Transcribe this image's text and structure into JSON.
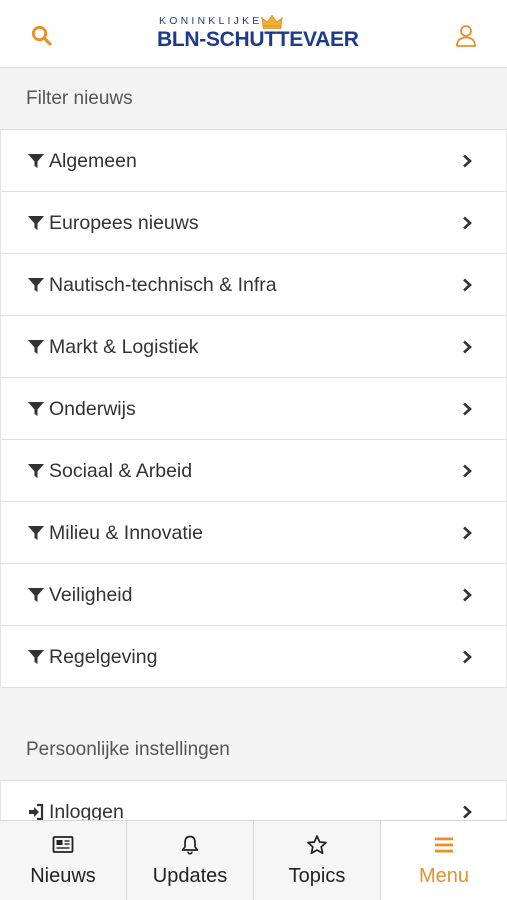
{
  "header": {
    "logo_top": "KONINKLIJKE",
    "logo_main": "BLN-SCHUTTEVAER",
    "search_icon": "search-icon",
    "user_icon": "user-icon"
  },
  "colors": {
    "accent": "#e8902a",
    "brand_blue": "#1e3a8a",
    "background": "#f4f4f4"
  },
  "filter": {
    "title": "Filter nieuws",
    "items": [
      {
        "label": "Algemeen",
        "icon": "filter-icon"
      },
      {
        "label": "Europees nieuws",
        "icon": "filter-icon"
      },
      {
        "label": "Nautisch-technisch & Infra",
        "icon": "filter-icon"
      },
      {
        "label": "Markt & Logistiek",
        "icon": "filter-icon"
      },
      {
        "label": "Onderwijs",
        "icon": "filter-icon"
      },
      {
        "label": "Sociaal & Arbeid",
        "icon": "filter-icon"
      },
      {
        "label": "Milieu & Innovatie",
        "icon": "filter-icon"
      },
      {
        "label": "Veiligheid",
        "icon": "filter-icon"
      },
      {
        "label": "Regelgeving",
        "icon": "filter-icon"
      }
    ]
  },
  "settings": {
    "title": "Persoonlijke instellingen",
    "items": [
      {
        "label": "Inloggen",
        "icon": "sign-in-icon"
      }
    ]
  },
  "tabbar": {
    "tabs": [
      {
        "label": "Nieuws",
        "icon": "newspaper-icon",
        "active": false
      },
      {
        "label": "Updates",
        "icon": "bell-icon",
        "active": false
      },
      {
        "label": "Topics",
        "icon": "star-icon",
        "active": false
      },
      {
        "label": "Menu",
        "icon": "menu-icon",
        "active": true
      }
    ]
  }
}
